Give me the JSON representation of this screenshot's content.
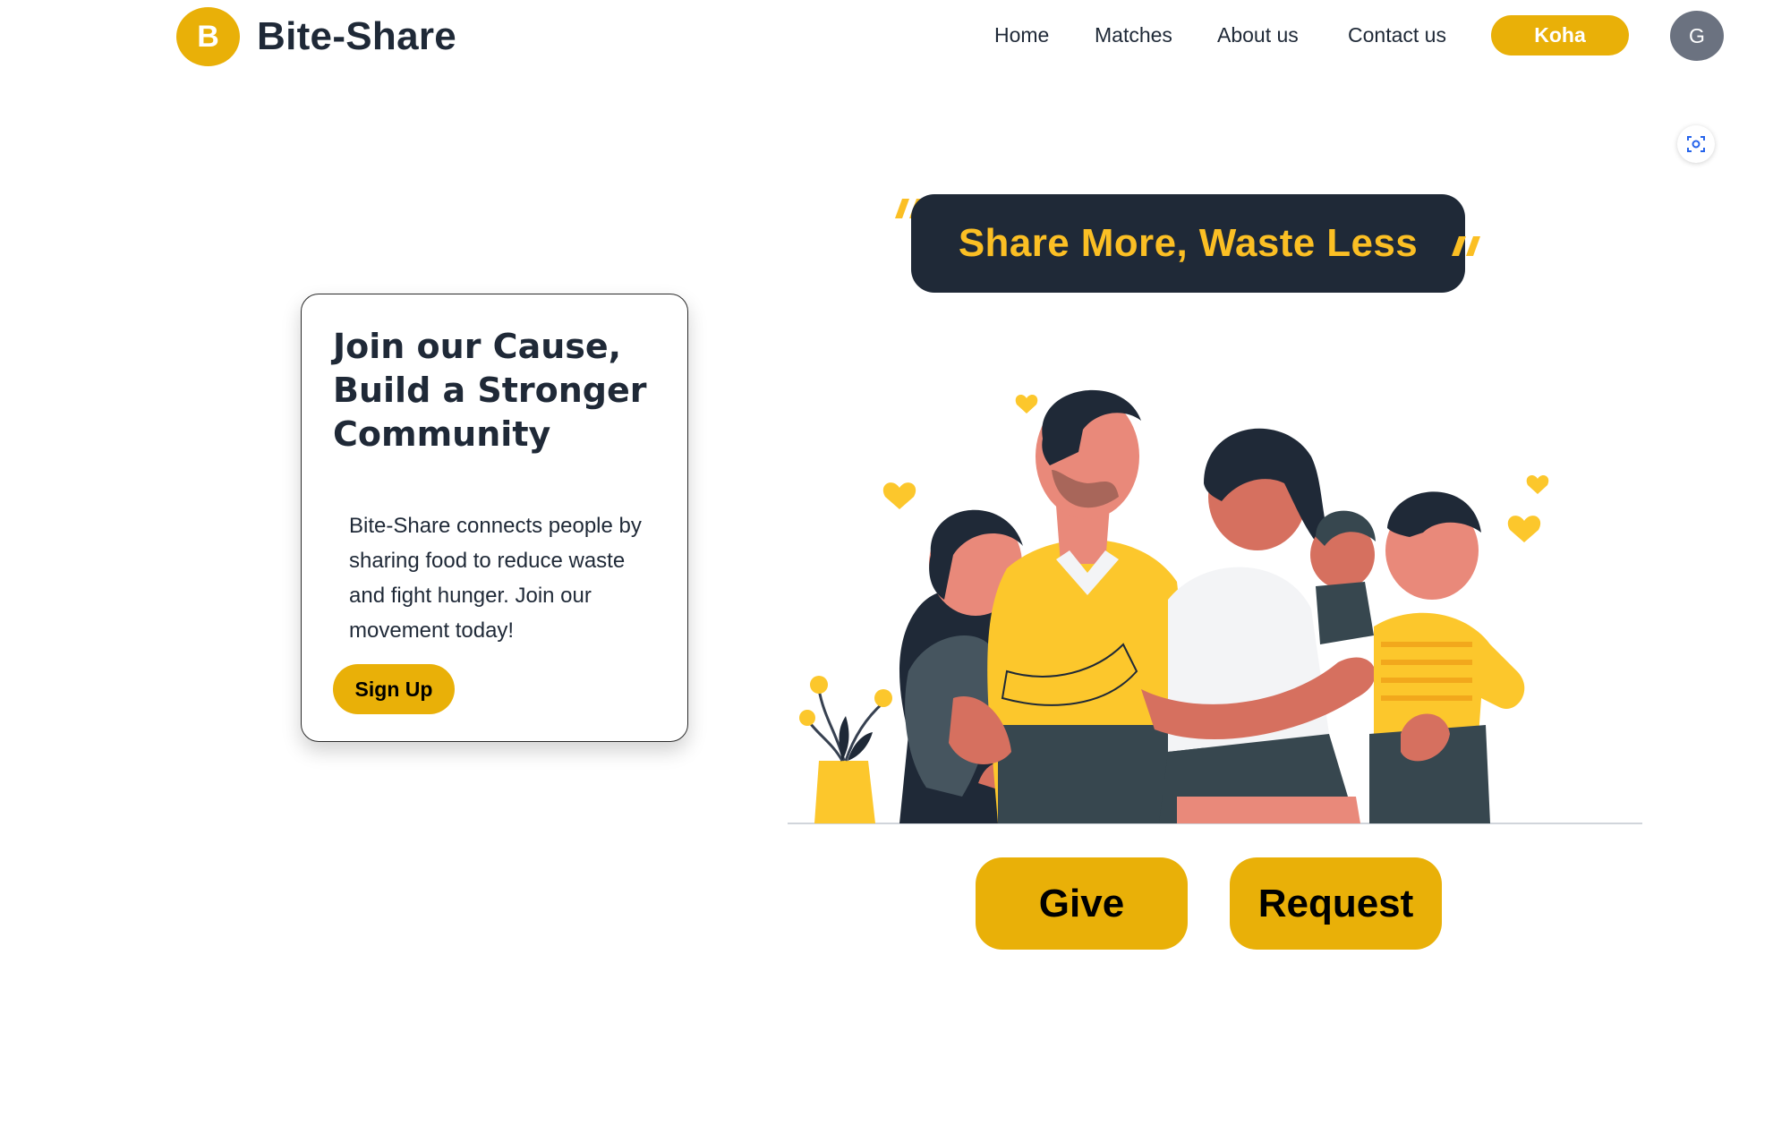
{
  "header": {
    "logo_letter": "B",
    "brand": "Bite-Share",
    "nav": [
      "Home",
      "Matches",
      "About us",
      "Contact us"
    ],
    "donate_label": "Koha",
    "avatar_letter": "G"
  },
  "card": {
    "title": "Join our Cause, Build a Stronger Community",
    "body": "Bite-Share connects people by sharing food to reduce waste and fight hunger. Join our movement today!",
    "signup_label": "Sign Up"
  },
  "hero": {
    "slogan": "Share More, Waste Less",
    "give_label": "Give",
    "request_label": "Request"
  },
  "colors": {
    "accent": "#e9b008",
    "slogan_text": "#fbbf24",
    "dark": "#1f2937",
    "avatar_bg": "#6b7280"
  },
  "icons": [
    "screenshot-capture-icon",
    "quote-open-icon",
    "quote-close-icon"
  ]
}
